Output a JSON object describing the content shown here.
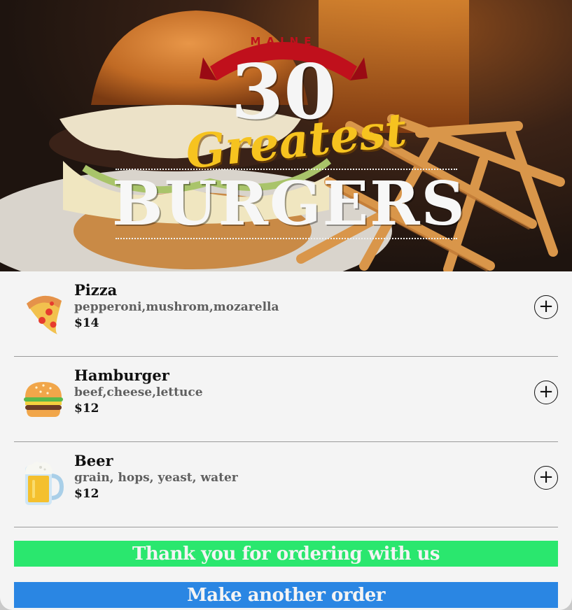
{
  "hero": {
    "ribbon_text": "MAINE",
    "number": "30",
    "script": "Greatest",
    "main": "BURGERS"
  },
  "menu": {
    "items": [
      {
        "name": "Pizza",
        "description": "pepperoni,mushrom,mozarella",
        "price": "$14",
        "icon": "pizza-icon",
        "add_label": "+"
      },
      {
        "name": "Hamburger",
        "description": "beef,cheese,lettuce",
        "price": "$12",
        "icon": "hamburger-icon",
        "add_label": "+"
      },
      {
        "name": "Beer",
        "description": "grain, hops, yeast, water",
        "price": "$12",
        "icon": "beer-icon",
        "add_label": "+"
      }
    ]
  },
  "confirmation": {
    "message": "Thank you for ordering with us"
  },
  "actions": {
    "make_another_order": "Make another order"
  },
  "colors": {
    "thanks_bar": "#2ae76e",
    "order_bar": "#2a86e3",
    "ribbon": "#c0101c",
    "script_gold": "#f6c31f"
  }
}
